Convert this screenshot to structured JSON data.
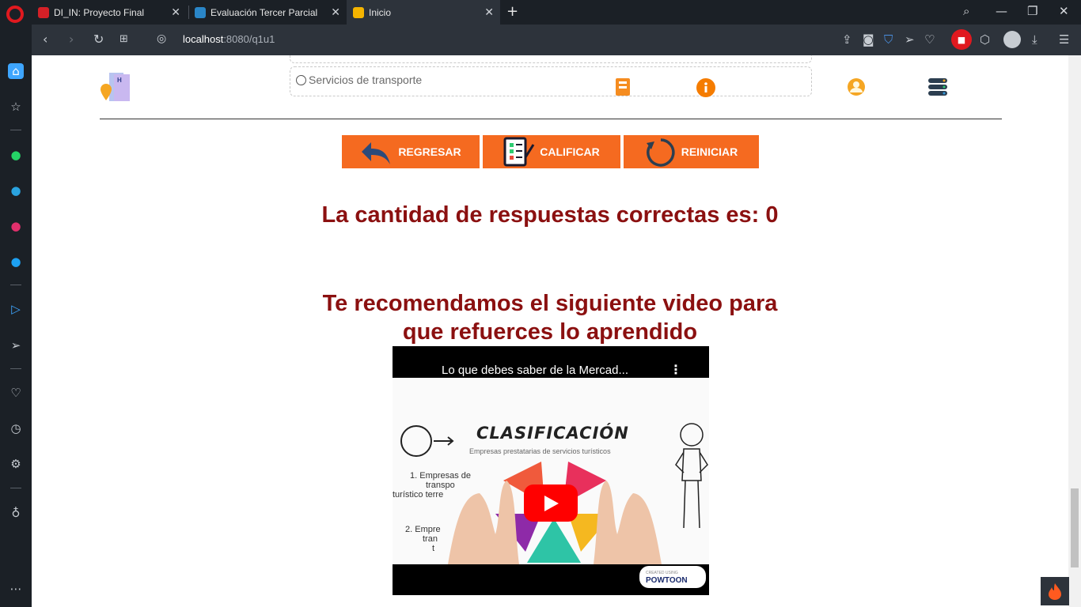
{
  "browser": {
    "tabs": [
      {
        "title": "DI_IN: Proyecto Final",
        "active": false
      },
      {
        "title": "Evaluación Tercer Parcial",
        "active": false
      },
      {
        "title": "Inicio",
        "active": true
      }
    ],
    "url_host": "localhost",
    "url_rest": ":8080/q1u1"
  },
  "quiz": {
    "option_label": "Servicios de transporte"
  },
  "buttons": {
    "back": "REGRESAR",
    "grade": "CALIFICAR",
    "restart": "REINICIAR"
  },
  "result": {
    "text": "La cantidad de respuestas correctas es: 0"
  },
  "recommend": {
    "line1": "Te recomendamos el siguiente video para",
    "line2": "que refuerces lo aprendido"
  },
  "video": {
    "title": "Lo que debes saber de la Mercad...",
    "heading": "CLASIFICACIÓN",
    "subheading": "Empresas prestatarias de servicios turísticos",
    "item1_line1": "1. Empresas de",
    "item1_line2": "transpo",
    "item1_line3": "turístico terre",
    "item2_line1": "2. Empre",
    "item2_line2": "tran",
    "item2_line3": "t",
    "badge_small": "CREATED USING",
    "badge": "POWTOON"
  },
  "colors": {
    "accent_orange": "#f56a20",
    "heading_red": "#8b1010",
    "chrome_dark": "#1b2026",
    "chrome_mid": "#2d333b"
  }
}
